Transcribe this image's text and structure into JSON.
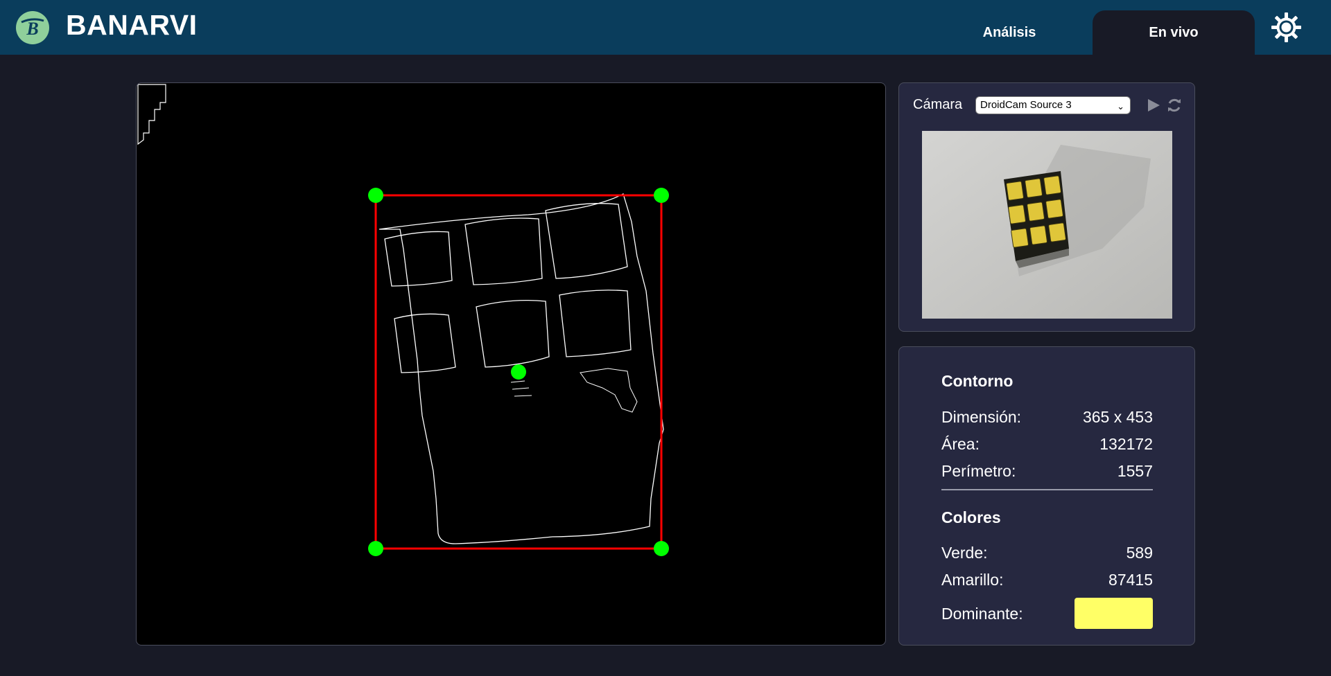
{
  "app": {
    "brand": "BANARVI",
    "logo_letter": "B"
  },
  "nav": {
    "tabs": [
      {
        "label": "Análisis",
        "active": false
      },
      {
        "label": "En vivo",
        "active": true
      }
    ],
    "settings_icon": "gear-icon"
  },
  "camera": {
    "label": "Cámara",
    "selected_source": "DroidCam Source 3",
    "play_icon": "play-icon",
    "refresh_icon": "refresh-icon"
  },
  "stats": {
    "contour_title": "Contorno",
    "dimension_label": "Dimensión:",
    "dimension_value": "365 x 453",
    "area_label": "Área:",
    "area_value": "132172",
    "perimeter_label": "Perímetro:",
    "perimeter_value": "1557",
    "colors_title": "Colores",
    "green_label": "Verde:",
    "green_value": "589",
    "yellow_label": "Amarillo:",
    "yellow_value": "87415",
    "dominant_label": "Dominante:",
    "dominant_color": "#ffff66"
  },
  "colors": {
    "header_bg": "#0a3d5c",
    "page_bg": "#181a26",
    "panel_bg": "#262840",
    "bounding_box": "#ff0000",
    "corner_points": "#00ff00",
    "edges": "#ffffff"
  }
}
